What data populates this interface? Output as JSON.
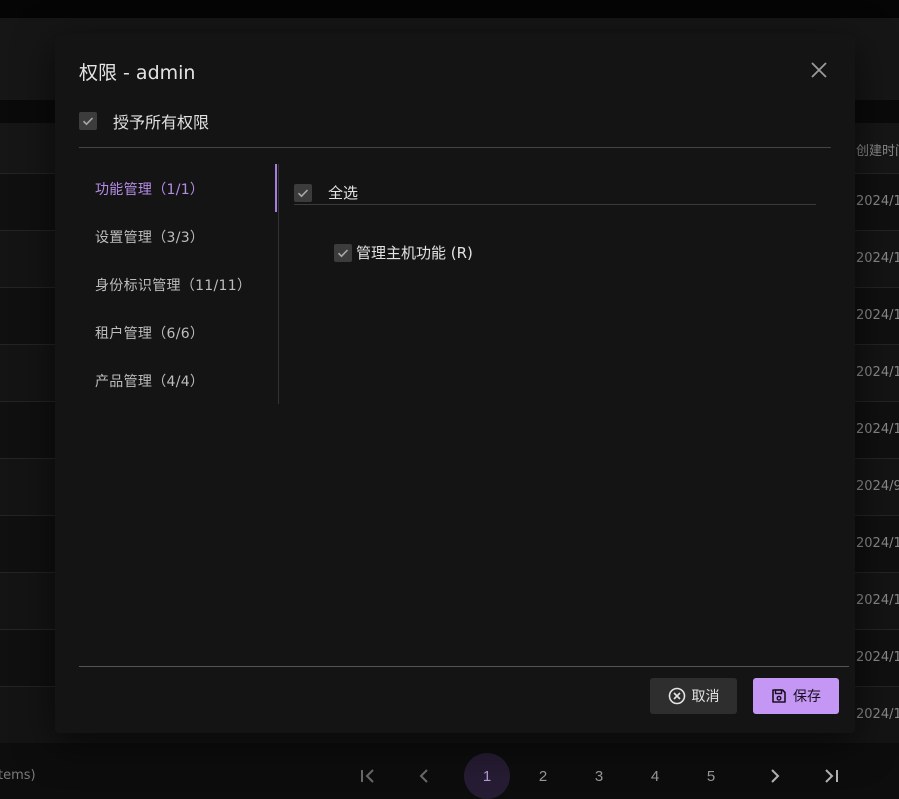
{
  "background": {
    "column_header": "创建时间",
    "row_dates": [
      "2024/1",
      "2024/1",
      "2024/1",
      "2024/1",
      "2024/1",
      "2024/9",
      "2024/1",
      "2024/1",
      "2024/1",
      "2024/1"
    ],
    "pagination": {
      "items_text": "tems)",
      "pages": [
        "1",
        "2",
        "3",
        "4",
        "5"
      ],
      "active_page": "1"
    }
  },
  "modal": {
    "title": "权限 - admin",
    "grant_all_label": "授予所有权限",
    "grant_all_checked": true,
    "tabs": [
      {
        "label": "功能管理（1/1）",
        "active": true
      },
      {
        "label": "设置管理（3/3）",
        "active": false
      },
      {
        "label": "身份标识管理（11/11）",
        "active": false
      },
      {
        "label": "租户管理（6/6）",
        "active": false
      },
      {
        "label": "产品管理（4/4）",
        "active": false
      }
    ],
    "select_all_label": "全选",
    "permissions": [
      {
        "label": "管理主机功能 (R)",
        "checked": true
      }
    ],
    "cancel_label": "取消",
    "save_label": "保存"
  },
  "colors": {
    "accent": "#c497f5",
    "tab_active": "#b58de6",
    "modal_bg": "#141414"
  }
}
